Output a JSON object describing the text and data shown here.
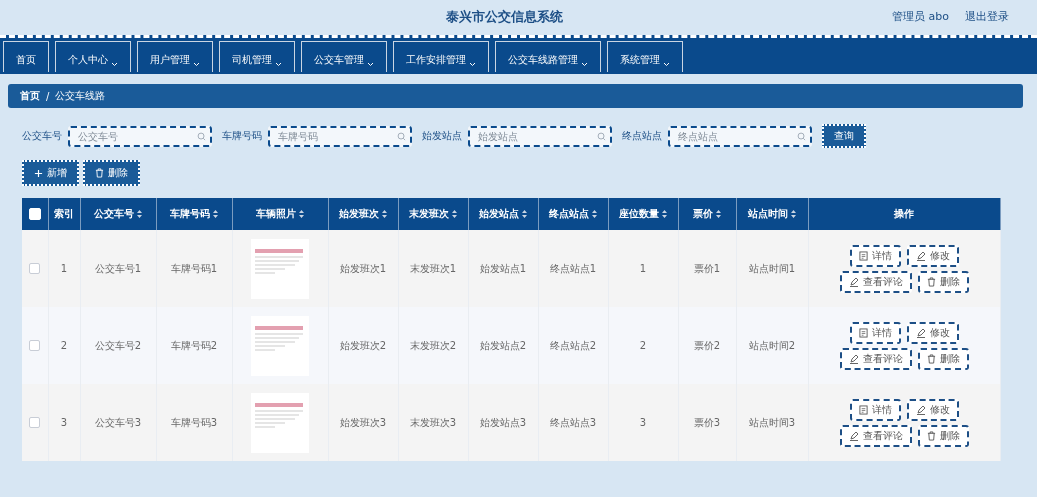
{
  "header": {
    "title": "泰兴市公交信息系统",
    "user": "管理员 abo",
    "logout": "退出登录"
  },
  "nav": [
    {
      "label": "首页",
      "dropdown": false
    },
    {
      "label": "个人中心",
      "dropdown": true
    },
    {
      "label": "用户管理",
      "dropdown": true
    },
    {
      "label": "司机管理",
      "dropdown": true
    },
    {
      "label": "公交车管理",
      "dropdown": true
    },
    {
      "label": "工作安排管理",
      "dropdown": true
    },
    {
      "label": "公交车线路管理",
      "dropdown": true
    },
    {
      "label": "系统管理",
      "dropdown": true
    }
  ],
  "breadcrumb": {
    "items": [
      "首页",
      "公交车线路"
    ],
    "separator": "/"
  },
  "search": {
    "fields": [
      {
        "label": "公交车号",
        "placeholder": "公交车号"
      },
      {
        "label": "车牌号码",
        "placeholder": "车牌号码"
      },
      {
        "label": "始发站点",
        "placeholder": "始发站点"
      },
      {
        "label": "终点站点",
        "placeholder": "终点站点"
      }
    ],
    "button": "查询"
  },
  "toolbar": [
    {
      "kind": "add",
      "label": "新增"
    },
    {
      "kind": "delete",
      "label": "删除"
    }
  ],
  "table": {
    "all_checked": false,
    "columns": [
      {
        "label": "索引",
        "sortable": false
      },
      {
        "label": "公交车号",
        "sortable": true
      },
      {
        "label": "车牌号码",
        "sortable": true
      },
      {
        "label": "车辆照片",
        "sortable": true
      },
      {
        "label": "始发班次",
        "sortable": true
      },
      {
        "label": "末发班次",
        "sortable": true
      },
      {
        "label": "始发站点",
        "sortable": true
      },
      {
        "label": "终点站点",
        "sortable": true
      },
      {
        "label": "座位数量",
        "sortable": true
      },
      {
        "label": "票价",
        "sortable": true
      },
      {
        "label": "站点时间",
        "sortable": true
      },
      {
        "label": "操作",
        "sortable": false
      }
    ],
    "rows": [
      {
        "checked": false,
        "cells": [
          "1",
          "公交车号1",
          "车牌号码1",
          "",
          "始发班次1",
          "末发班次1",
          "始发站点1",
          "终点站点1",
          "1",
          "票价1",
          "站点时间1"
        ],
        "actions": [
          {
            "kind": "detail",
            "label": "详情"
          },
          {
            "kind": "edit",
            "label": "修改"
          },
          {
            "kind": "comment",
            "label": "查看评论"
          },
          {
            "kind": "delete",
            "label": "删除"
          }
        ]
      },
      {
        "checked": false,
        "cells": [
          "2",
          "公交车号2",
          "车牌号码2",
          "",
          "始发班次2",
          "末发班次2",
          "始发站点2",
          "终点站点2",
          "2",
          "票价2",
          "站点时间2"
        ],
        "actions": [
          {
            "kind": "detail",
            "label": "详情"
          },
          {
            "kind": "edit",
            "label": "修改"
          },
          {
            "kind": "comment",
            "label": "查看评论"
          },
          {
            "kind": "delete",
            "label": "删除"
          }
        ]
      },
      {
        "checked": false,
        "cells": [
          "3",
          "公交车号3",
          "车牌号码3",
          "",
          "始发班次3",
          "末发班次3",
          "始发站点3",
          "终点站点3",
          "3",
          "票价3",
          "站点时间3"
        ],
        "actions": [
          {
            "kind": "detail",
            "label": "详情"
          },
          {
            "kind": "edit",
            "label": "修改"
          },
          {
            "kind": "comment",
            "label": "查看评论"
          },
          {
            "kind": "delete",
            "label": "删除"
          }
        ]
      }
    ]
  }
}
